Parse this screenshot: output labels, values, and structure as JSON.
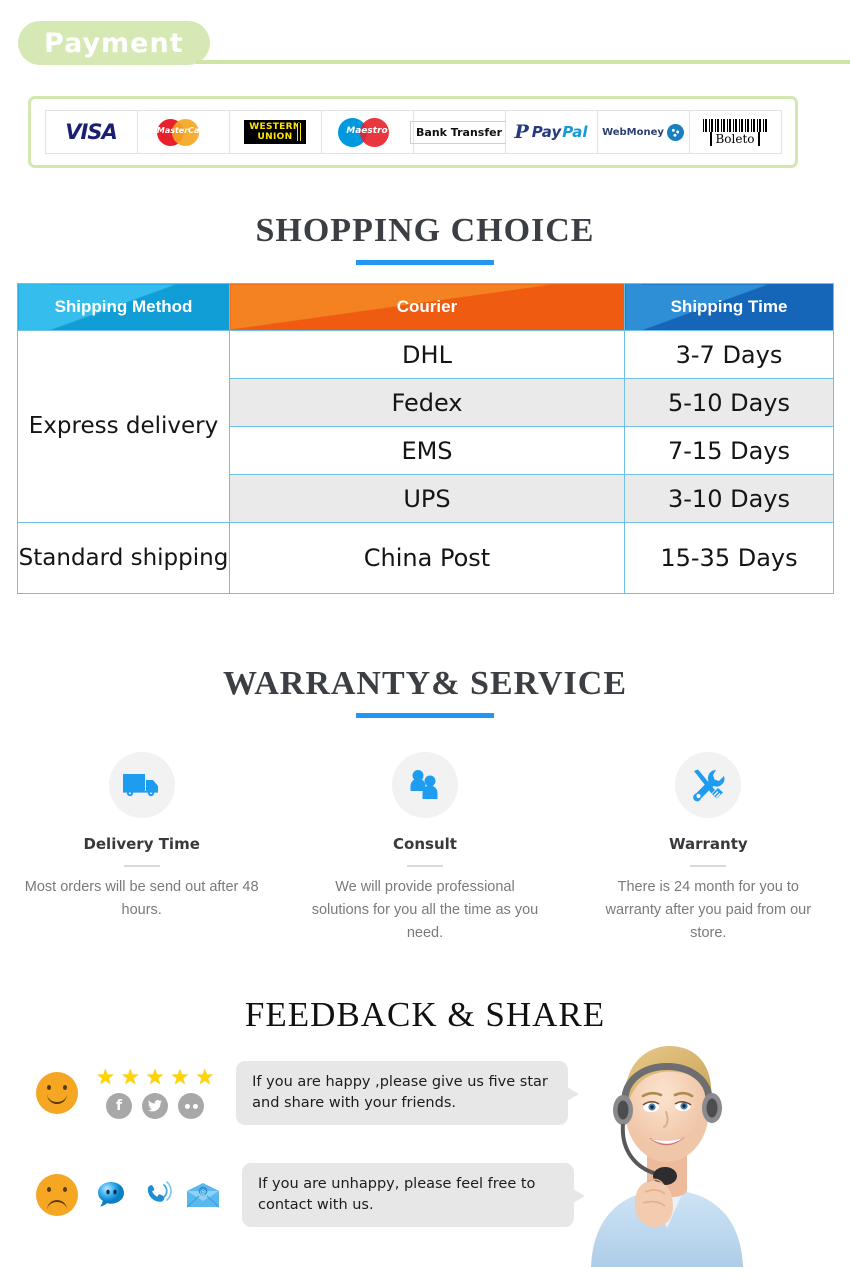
{
  "payment": {
    "heading": "Payment",
    "methods": [
      {
        "name": "visa",
        "label": "VISA"
      },
      {
        "name": "mastercard",
        "label": "MasterCard"
      },
      {
        "name": "western-union",
        "line1": "WESTERN",
        "line2": "UNION"
      },
      {
        "name": "maestro",
        "label": "Maestro"
      },
      {
        "name": "bank-transfer",
        "label": "Bank Transfer"
      },
      {
        "name": "paypal",
        "glyph": "P",
        "word1": "Pay",
        "word2": "Pal"
      },
      {
        "name": "webmoney",
        "label": "WebMoney"
      },
      {
        "name": "boleto",
        "label": "Boleto"
      }
    ]
  },
  "shopping": {
    "title": "SHOPPING CHOICE",
    "columns": [
      "Shipping Method",
      "Courier",
      "Shipping Time"
    ],
    "rows": [
      {
        "method": "Express delivery",
        "courier": "DHL",
        "time": "3-7  Days"
      },
      {
        "method": "",
        "courier": "Fedex",
        "time": "5-10 Days"
      },
      {
        "method": "",
        "courier": "EMS",
        "time": "7-15 Days"
      },
      {
        "method": "",
        "courier": "UPS",
        "time": "3-10 Days"
      },
      {
        "method": "Standard shipping",
        "courier": "China Post",
        "time": "15-35 Days"
      }
    ]
  },
  "warranty": {
    "title": "WARRANTY& SERVICE",
    "services": [
      {
        "icon": "delivery-truck-icon",
        "name": "Delivery Time",
        "desc": "Most orders will be send out after 48 hours."
      },
      {
        "icon": "two-people-icon",
        "name": "Consult",
        "desc": "We will provide professional solutions for you all the time as you need."
      },
      {
        "icon": "wrench-screwdriver-icon",
        "name": "Warranty",
        "desc": "There is 24 month for you to warranty after you paid from our store."
      }
    ]
  },
  "feedback": {
    "title": "FEEDBACK & SHARE",
    "happy": {
      "face": "happy-face-icon",
      "star_count": 5,
      "star_glyph": "★",
      "socials": [
        {
          "name": "facebook-icon",
          "glyph": "f"
        },
        {
          "name": "twitter-icon",
          "glyph": "✉"
        },
        {
          "name": "flickr-icon",
          "glyph": ""
        }
      ],
      "message": "If you are happy ,please give us five star and share with your friends."
    },
    "unhappy": {
      "face": "sad-face-icon",
      "contacts": [
        "chat-bubble-icon",
        "phone-ringing-icon",
        "email-envelope-icon"
      ],
      "message": "If you are unhappy, please feel free to contact with us."
    }
  },
  "colors": {
    "green_pill": "#d6e9b4",
    "green_rule": "#cfe5a8",
    "accent_blue": "#2196f3",
    "header_cyan": "#35bdee",
    "header_orange": "#f58220",
    "header_blue": "#2f8fd6",
    "star_yellow": "#ffd400",
    "face_orange": "#f5a623"
  }
}
